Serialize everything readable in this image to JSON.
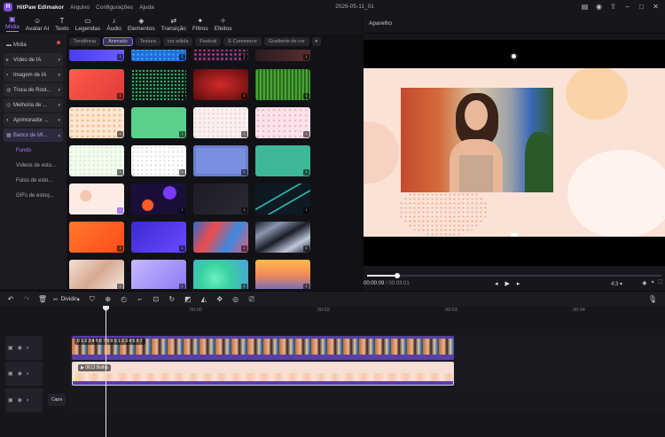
{
  "window": {
    "app_name": "HitPaw Edimakor",
    "menu": [
      "Arquivo",
      "Configurações",
      "Ajuda"
    ],
    "doc_title": "2026-05-11_01"
  },
  "toolbar": {
    "tabs": [
      {
        "label": "Mídia",
        "icon": "media-icon",
        "active": true
      },
      {
        "label": "Avatar AI",
        "icon": "avatar-icon"
      },
      {
        "label": "Texto",
        "icon": "text-icon"
      },
      {
        "label": "Legendas",
        "icon": "captions-icon"
      },
      {
        "label": "Áudio",
        "icon": "audio-icon"
      },
      {
        "label": "Elementos",
        "icon": "elements-icon"
      },
      {
        "label": "Transição",
        "icon": "transition-icon"
      },
      {
        "label": "Filtros",
        "icon": "filters-icon"
      },
      {
        "label": "Efeitos",
        "icon": "effects-icon"
      }
    ]
  },
  "sidebar": {
    "items": [
      {
        "label": "Mídia",
        "style": "plain"
      },
      {
        "label": "Vídeo de IA",
        "style": "box"
      },
      {
        "label": "Imagem de IA",
        "style": "box"
      },
      {
        "label": "Troca de Rost...",
        "style": "box"
      },
      {
        "label": "Melhoria de ...",
        "style": "box"
      },
      {
        "label": "Aprimorador ...",
        "style": "box"
      },
      {
        "label": "Banco de Mí...",
        "style": "selected"
      }
    ],
    "subitems": [
      {
        "label": "Fundo",
        "active": true
      },
      {
        "label": "Vídeos de esto..."
      },
      {
        "label": "Fotos de esto..."
      },
      {
        "label": "GIFs de estoq..."
      }
    ]
  },
  "filters": {
    "chips": [
      "Tendência",
      "Animado",
      "Textura",
      "cor sólida",
      "Festival",
      "E-Commerce",
      "Gradiente de cor"
    ],
    "active": "Animado"
  },
  "preview": {
    "title": "Aparelho",
    "current_time": "00:00:09",
    "total_time": "00:03:01",
    "progress": 0.1,
    "ratio": "4:3"
  },
  "timeline": {
    "split_label": "Dividir",
    "ruler": [
      "00:00",
      "00:02",
      "00:03",
      "00:04"
    ],
    "video_clip_label": "0 1 2 3 4 5 6 7 8 9 0 1 2 3 4 5 6 7",
    "bg_clip_label": "0613 Bolha",
    "layer_button": "Capa"
  },
  "colors": {
    "accent": "#a77cff",
    "video_clip": "#5a3ea8",
    "bg": "#121216"
  }
}
